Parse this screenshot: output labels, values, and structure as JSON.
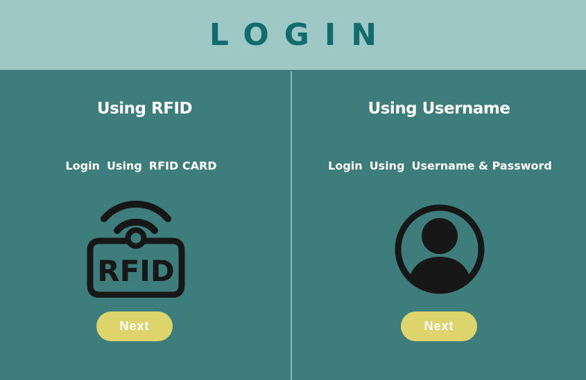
{
  "colors": {
    "header_bg": "#9ec8c6",
    "title_color": "#126b6c",
    "main_bg": "#3d7e7d",
    "divider": "#8fb8b6",
    "text_white": "#ffffff",
    "icon_dark": "#171717",
    "button_bg": "#ded46c",
    "button_text": "#ffffff"
  },
  "header": {
    "title": "LOGIN"
  },
  "rfid_panel": {
    "heading": "Using RFID",
    "subtitle": [
      "Login",
      "Using",
      "RFID CARD"
    ],
    "icon": "rfid-card-icon",
    "icon_text": "RFID",
    "button_label": "Next"
  },
  "username_panel": {
    "heading": "Using Username",
    "subtitle": [
      "Login",
      "Using",
      "Username & Password"
    ],
    "icon": "user-avatar-icon",
    "button_label": "Next"
  }
}
